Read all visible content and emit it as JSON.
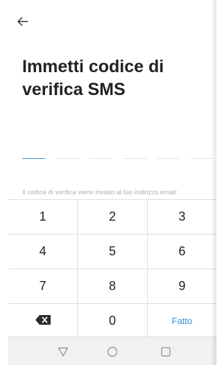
{
  "header": {
    "back_icon": "arrow-left-icon",
    "title": "Immetti codice di verifica SMS"
  },
  "code_input": {
    "slots": 6,
    "active_slot": 1
  },
  "hint": "Il codice di verifica viene inviato al tuo indirizzo email:",
  "keypad": {
    "rows": [
      [
        "1",
        "2",
        "3"
      ],
      [
        "4",
        "5",
        "6"
      ],
      [
        "7",
        "8",
        "9"
      ]
    ],
    "backspace_icon": "backspace-icon",
    "zero": "0",
    "done_label": "Fatto"
  },
  "navbar": {
    "back_icon": "triangle-back-icon",
    "home_icon": "circle-home-icon",
    "recents_icon": "square-recents-icon"
  },
  "colors": {
    "accent": "#3a8ed3",
    "title": "#222222",
    "hint": "#b0b0b0"
  }
}
